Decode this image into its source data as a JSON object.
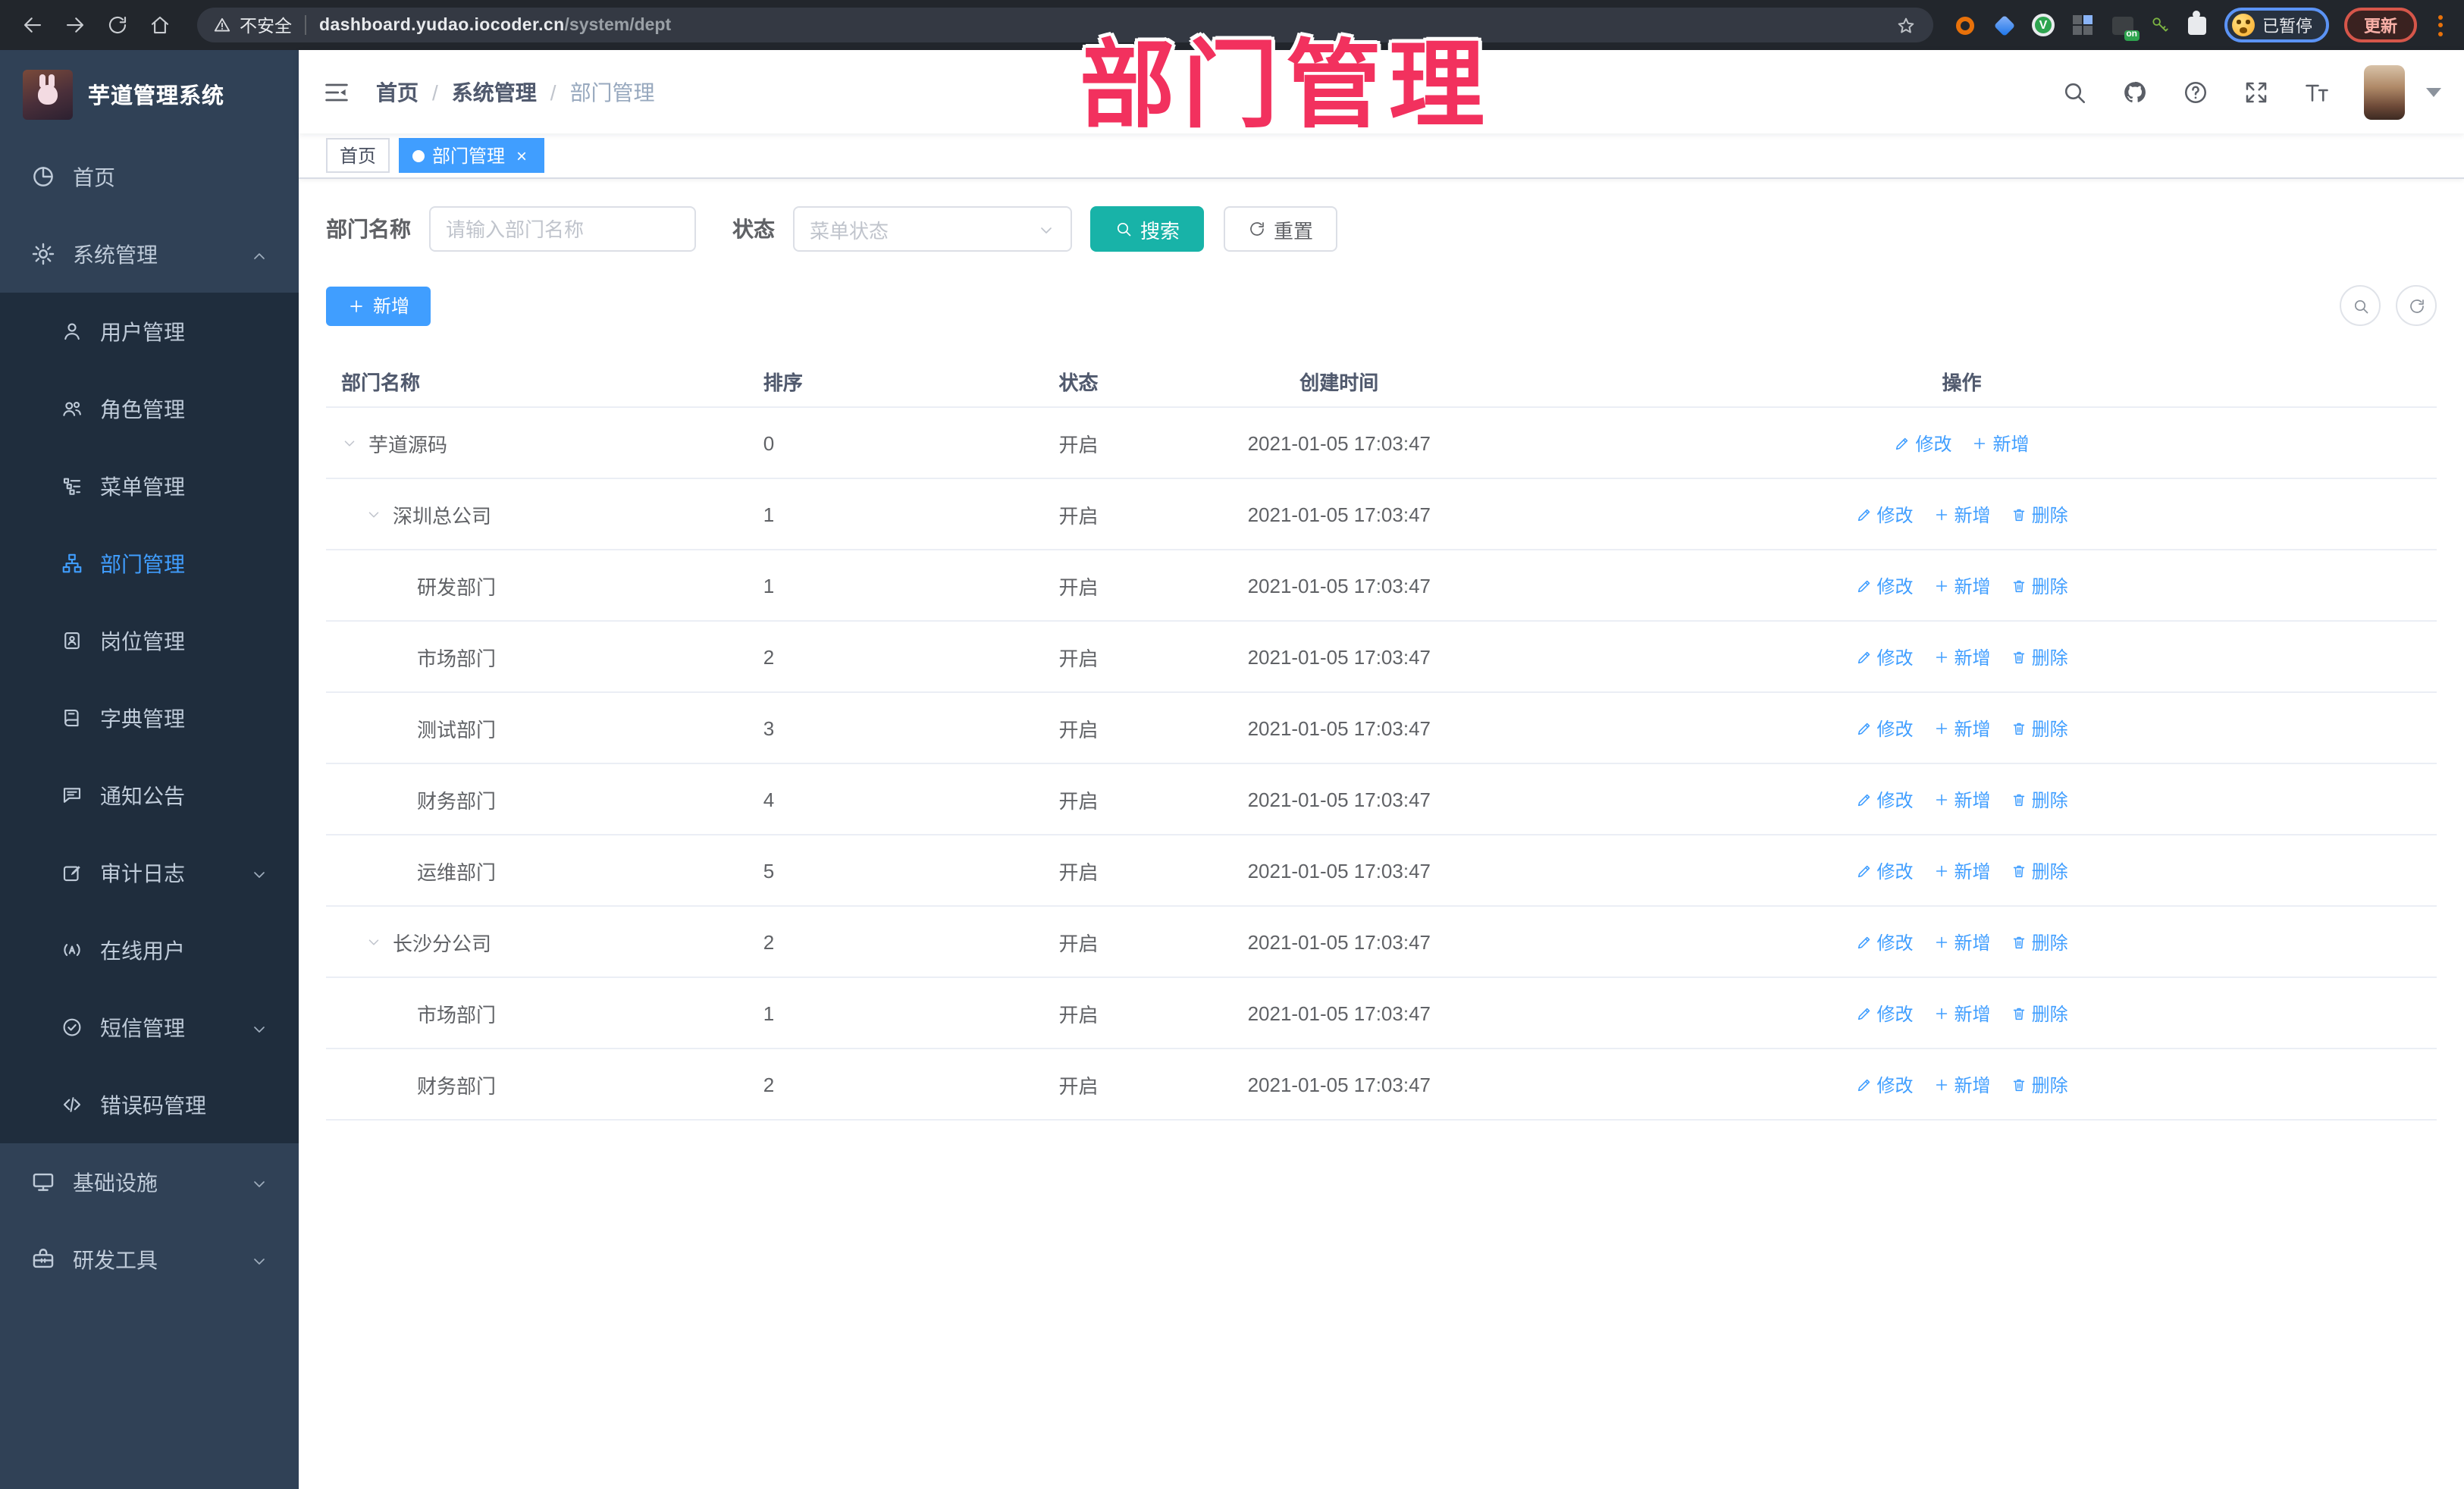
{
  "browser": {
    "security_label": "不安全",
    "url_host": "dashboard.yudao.iocoder.cn",
    "url_path": "/system/dept",
    "profile_label": "已暂停",
    "update_label": "更新"
  },
  "sidebar": {
    "title": "芋道管理系统",
    "menu": [
      {
        "name": "home",
        "label": "首页",
        "icon": "i-dashboard"
      },
      {
        "name": "system",
        "label": "系统管理",
        "icon": "i-gear",
        "expanded": true,
        "children": [
          {
            "name": "user",
            "label": "用户管理",
            "icon": "i-user"
          },
          {
            "name": "role",
            "label": "角色管理",
            "icon": "i-users"
          },
          {
            "name": "menu",
            "label": "菜单管理",
            "icon": "i-menulist"
          },
          {
            "name": "dept",
            "label": "部门管理",
            "icon": "i-org",
            "active": true
          },
          {
            "name": "post",
            "label": "岗位管理",
            "icon": "i-post"
          },
          {
            "name": "dict",
            "label": "字典管理",
            "icon": "i-dict"
          },
          {
            "name": "notice",
            "label": "通知公告",
            "icon": "i-notice"
          },
          {
            "name": "audit-log",
            "label": "审计日志",
            "icon": "i-log",
            "arrow": "down"
          },
          {
            "name": "online",
            "label": "在线用户",
            "icon": "i-online"
          },
          {
            "name": "sms",
            "label": "短信管理",
            "icon": "i-sms",
            "arrow": "down"
          },
          {
            "name": "errcode",
            "label": "错误码管理",
            "icon": "i-code"
          }
        ]
      },
      {
        "name": "infra",
        "label": "基础设施",
        "icon": "i-monitor",
        "arrow": "down"
      },
      {
        "name": "devtool",
        "label": "研发工具",
        "icon": "i-tool",
        "arrow": "down"
      }
    ]
  },
  "header": {
    "breadcrumb": [
      "首页",
      "系统管理",
      "部门管理"
    ]
  },
  "tags": [
    {
      "label": "首页",
      "active": false
    },
    {
      "label": "部门管理",
      "active": true
    }
  ],
  "overlay_title": "部门管理",
  "filters": {
    "dept_name_label": "部门名称",
    "dept_name_placeholder": "请输入部门名称",
    "status_label": "状态",
    "status_placeholder": "菜单状态",
    "search_label": "搜索",
    "reset_label": "重置"
  },
  "toolbar": {
    "add_label": "新增"
  },
  "table": {
    "columns": [
      "部门名称",
      "排序",
      "状态",
      "创建时间",
      "操作"
    ],
    "action_labels": {
      "edit": "修改",
      "add": "新增",
      "delete": "删除"
    },
    "rows": [
      {
        "name": "芋道源码",
        "level": 1,
        "caret": true,
        "sort": "0",
        "status": "开启",
        "created": "2021-01-05 17:03:47",
        "actions": [
          "edit",
          "add"
        ]
      },
      {
        "name": "深圳总公司",
        "level": 2,
        "caret": true,
        "sort": "1",
        "status": "开启",
        "created": "2021-01-05 17:03:47",
        "actions": [
          "edit",
          "add",
          "delete"
        ]
      },
      {
        "name": "研发部门",
        "level": 3,
        "caret": false,
        "sort": "1",
        "status": "开启",
        "created": "2021-01-05 17:03:47",
        "actions": [
          "edit",
          "add",
          "delete"
        ]
      },
      {
        "name": "市场部门",
        "level": 3,
        "caret": false,
        "sort": "2",
        "status": "开启",
        "created": "2021-01-05 17:03:47",
        "actions": [
          "edit",
          "add",
          "delete"
        ]
      },
      {
        "name": "测试部门",
        "level": 3,
        "caret": false,
        "sort": "3",
        "status": "开启",
        "created": "2021-01-05 17:03:47",
        "actions": [
          "edit",
          "add",
          "delete"
        ]
      },
      {
        "name": "财务部门",
        "level": 3,
        "caret": false,
        "sort": "4",
        "status": "开启",
        "created": "2021-01-05 17:03:47",
        "actions": [
          "edit",
          "add",
          "delete"
        ]
      },
      {
        "name": "运维部门",
        "level": 3,
        "caret": false,
        "sort": "5",
        "status": "开启",
        "created": "2021-01-05 17:03:47",
        "actions": [
          "edit",
          "add",
          "delete"
        ]
      },
      {
        "name": "长沙分公司",
        "level": 2,
        "caret": true,
        "sort": "2",
        "status": "开启",
        "created": "2021-01-05 17:03:47",
        "actions": [
          "edit",
          "add",
          "delete"
        ]
      },
      {
        "name": "市场部门",
        "level": 3,
        "caret": false,
        "sort": "1",
        "status": "开启",
        "created": "2021-01-05 17:03:47",
        "actions": [
          "edit",
          "add",
          "delete"
        ]
      },
      {
        "name": "财务部门",
        "level": 3,
        "caret": false,
        "sort": "2",
        "status": "开启",
        "created": "2021-01-05 17:03:47",
        "actions": [
          "edit",
          "add",
          "delete"
        ]
      }
    ]
  },
  "colors": {
    "accent": "#409EFF",
    "search_button": "#18B3A8",
    "overlay_pink": "#F2315E",
    "sidebar_bg": "#304156",
    "submenu_bg": "#1F2D3D"
  }
}
